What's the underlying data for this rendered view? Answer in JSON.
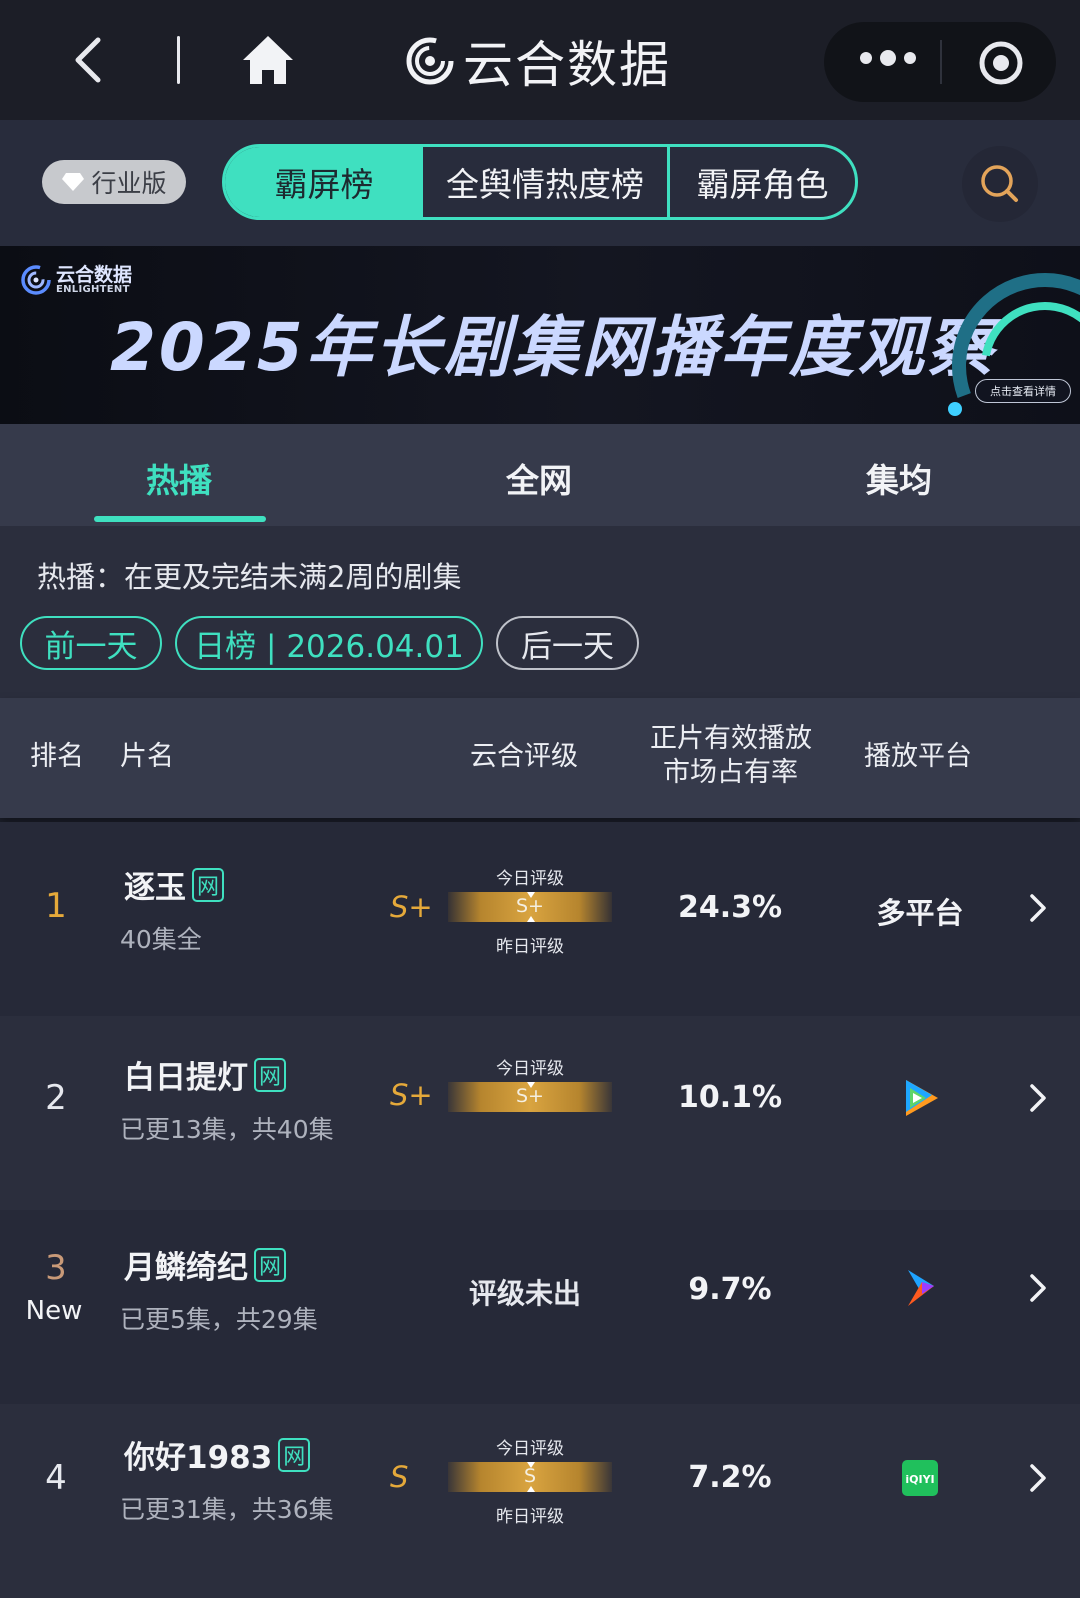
{
  "topbar": {
    "brand": "云合数据"
  },
  "filters": {
    "industry_badge": "行业版",
    "segments": [
      "霸屏榜",
      "全舆情热度榜",
      "霸屏角色"
    ]
  },
  "banner": {
    "logo_cn": "云合数据",
    "logo_en": "ENLIGHTENT",
    "title": "2025年长剧集网播年度观察",
    "cta": "点击查看详情"
  },
  "tabs": [
    "热播",
    "全网",
    "集均"
  ],
  "desc": "热播：在更及完结未满2周的剧集",
  "date": {
    "prev": "前一天",
    "current": "日榜 | 2026.04.01",
    "next": "后一天"
  },
  "table": {
    "headers": {
      "rank": "排名",
      "name": "片名",
      "grade": "云合评级",
      "share_line1": "正片有效播放",
      "share_line2": "市场占有率",
      "platform": "播放平台"
    },
    "today_label": "今日评级",
    "yesterday_label": "昨日评级",
    "net_badge": "网",
    "rows": [
      {
        "rank": "1",
        "new": "",
        "title": "逐玉",
        "sub": "40集全",
        "grade": "S+",
        "today": "S+",
        "share": "24.3%",
        "platform": "多平台",
        "platform_icon": ""
      },
      {
        "rank": "2",
        "new": "",
        "title": "白日提灯",
        "sub": "已更13集，共40集",
        "grade": "S+",
        "today": "S+",
        "share": "10.1%",
        "platform": "",
        "platform_icon": "tencent-video-icon"
      },
      {
        "rank": "3",
        "new": "New",
        "title": "月鳞绮纪",
        "sub": "已更5集，共29集",
        "grade_none": "评级未出",
        "share": "9.7%",
        "platform": "",
        "platform_icon": "youku-icon"
      },
      {
        "rank": "4",
        "new": "",
        "title": "你好1983",
        "sub": "已更31集，共36集",
        "grade": "S",
        "today": "S",
        "share": "7.2%",
        "platform": "",
        "platform_icon": "iqiyi-icon"
      }
    ]
  },
  "colors": {
    "accent": "#3fe0c0",
    "gold": "#e5a93a",
    "rank_bronze": "#c99a78"
  }
}
